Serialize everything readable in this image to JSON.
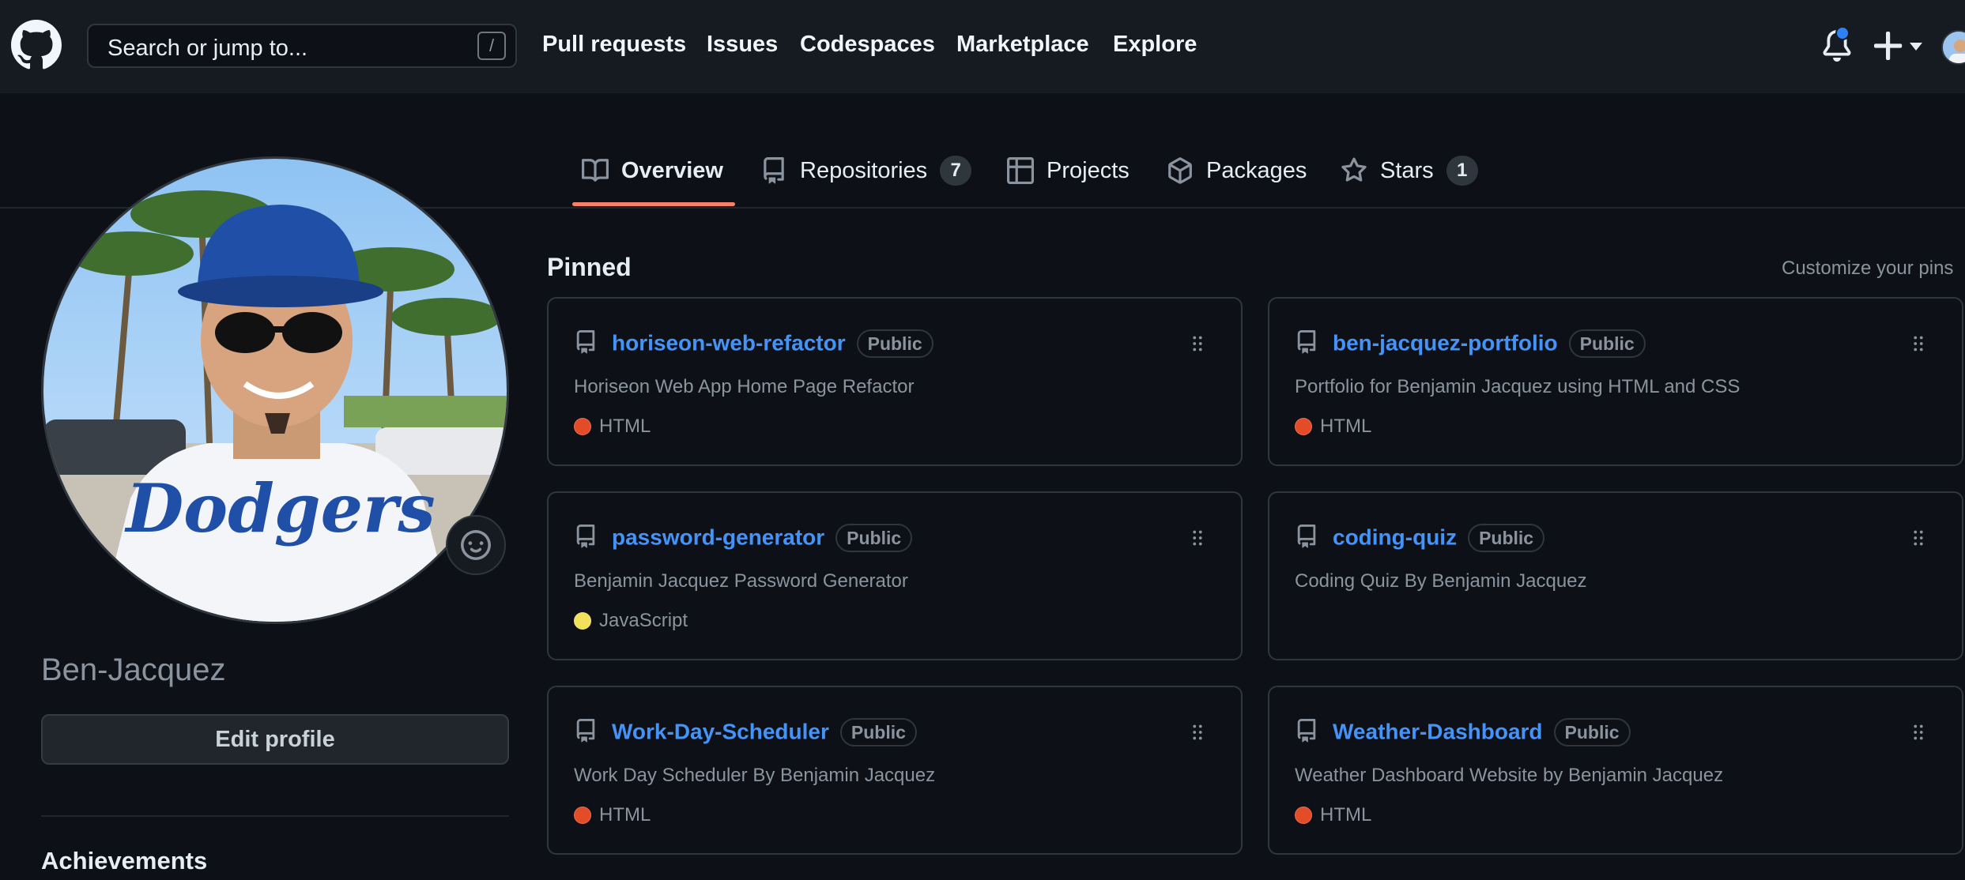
{
  "header": {
    "search_placeholder": "Search or jump to...",
    "search_shortcut": "/",
    "nav": [
      "Pull requests",
      "Issues",
      "Codespaces",
      "Marketplace",
      "Explore"
    ]
  },
  "tabs": [
    {
      "label": "Overview",
      "icon": "book-icon",
      "active": true
    },
    {
      "label": "Repositories",
      "icon": "repo-icon",
      "count": "7"
    },
    {
      "label": "Projects",
      "icon": "table-icon"
    },
    {
      "label": "Packages",
      "icon": "package-icon"
    },
    {
      "label": "Stars",
      "icon": "star-icon",
      "count": "1"
    }
  ],
  "profile": {
    "username": "Ben-Jacquez",
    "edit_label": "Edit profile",
    "achievements_label": "Achievements"
  },
  "pinned": {
    "title": "Pinned",
    "customize_label": "Customize your pins",
    "visibility_label": "Public",
    "repos": [
      {
        "name": "horiseon-web-refactor",
        "description": "Horiseon Web App Home Page Refactor",
        "language": "HTML",
        "lang_color": "#e34c26"
      },
      {
        "name": "ben-jacquez-portfolio",
        "description": "Portfolio for Benjamin Jacquez using HTML and CSS",
        "language": "HTML",
        "lang_color": "#e34c26"
      },
      {
        "name": "password-generator",
        "description": "Benjamin Jacquez Password Generator",
        "language": "JavaScript",
        "lang_color": "#f1e05a"
      },
      {
        "name": "coding-quiz",
        "description": "Coding Quiz By Benjamin Jacquez",
        "language": "",
        "lang_color": ""
      },
      {
        "name": "Work-Day-Scheduler",
        "description": "Work Day Scheduler By Benjamin Jacquez",
        "language": "HTML",
        "lang_color": "#e34c26"
      },
      {
        "name": "Weather-Dashboard",
        "description": "Weather Dashboard Website by Benjamin Jacquez",
        "language": "HTML",
        "lang_color": "#e34c26"
      }
    ]
  },
  "colors": {
    "link": "#4493f8",
    "tab_underline": "#f78166",
    "notification_dot": "#2f81f7"
  }
}
